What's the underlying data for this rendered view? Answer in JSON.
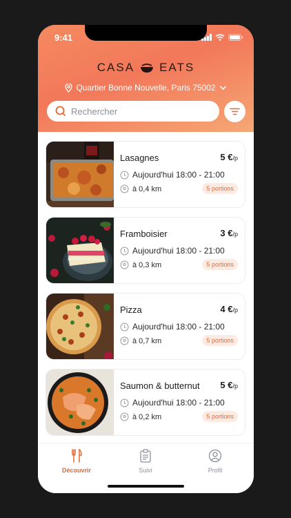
{
  "status": {
    "time": "9:41"
  },
  "brand": {
    "left": "CASA",
    "right": "EATS"
  },
  "location": {
    "text": "Quartier Bonne Nouvelle, Paris 75002"
  },
  "search": {
    "placeholder": "Rechercher"
  },
  "colors": {
    "accent": "#e8652f",
    "header_start": "#f58a60",
    "header_end": "#f6a775",
    "badge_bg": "#fdebe2"
  },
  "meals": [
    {
      "title": "Lasagnes",
      "price": "5 €",
      "price_unit": "/p",
      "time": "Aujourd'hui 18:00 - 21:00",
      "distance": "à 0,4 km",
      "portions": "5 portions"
    },
    {
      "title": "Framboisier",
      "price": "3 €",
      "price_unit": "/p",
      "time": "Aujourd'hui 18:00 - 21:00",
      "distance": "à 0,3 km",
      "portions": "5 portions"
    },
    {
      "title": "Pizza",
      "price": "4 €",
      "price_unit": "/p",
      "time": "Aujourd'hui 18:00 - 21:00",
      "distance": "à 0,7 km",
      "portions": "5 portions"
    },
    {
      "title": "Saumon & butternut",
      "price": "5 €",
      "price_unit": "/p",
      "time": "Aujourd'hui 18:00 - 21:00",
      "distance": "à 0,2 km",
      "portions": "5 portions"
    }
  ],
  "tabs": [
    {
      "label": "Découvrir",
      "icon": "utensils-icon",
      "active": true
    },
    {
      "label": "Suivi",
      "icon": "clipboard-icon",
      "active": false
    },
    {
      "label": "Profil",
      "icon": "user-icon",
      "active": false
    }
  ]
}
